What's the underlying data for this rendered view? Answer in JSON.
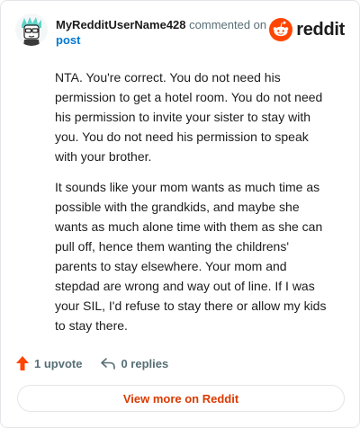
{
  "header": {
    "username": "MyRedditUserName428",
    "commented_text": "commented on",
    "post_link": "post",
    "brand_name": "reddit"
  },
  "comment": {
    "paragraphs": [
      "NTA. You're correct. You do not need his permission to get a hotel room. You do not need his permission to invite your sister to stay with you. You do not need his permission to speak with your brother.",
      "It sounds like your mom wants as much time as possible with the grandkids, and maybe she wants as much alone time with them as she can pull off, hence them wanting the childrens' parents to stay elsewhere. Your mom and stepdad are wrong and way out of line. If I was your SIL, I'd refuse to stay there or allow my kids to stay there."
    ]
  },
  "actions": {
    "upvote_label": "1 upvote",
    "replies_label": "0 replies",
    "upvote_icon": "upvote-arrow-icon",
    "reply_icon": "reply-arrow-icon"
  },
  "footer": {
    "view_more_label": "View more on Reddit"
  },
  "colors": {
    "brand_orange": "#ff4500",
    "link_blue": "#0079d3",
    "view_more_text": "#d93a00",
    "upvote": "#ff4500",
    "muted": "#576f76"
  }
}
